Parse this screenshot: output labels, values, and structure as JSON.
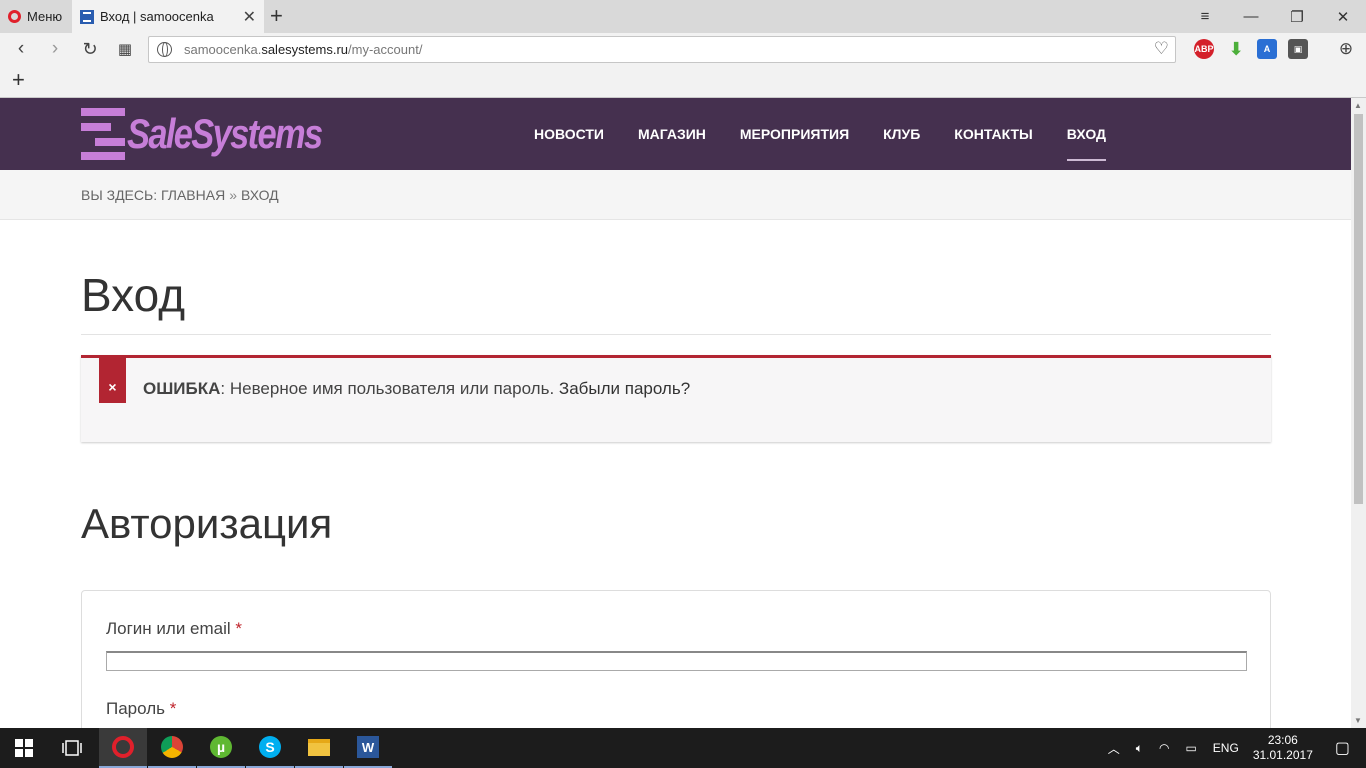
{
  "browser": {
    "menu_label": "Меню",
    "tab_title": "Вход | samoocenka",
    "url_prefix": "samoocenka.",
    "url_host": "salesystems.ru",
    "url_path": "/my-account/",
    "extensions": [
      {
        "name": "adblock-icon",
        "label": "ABP",
        "color": "#d4202a"
      },
      {
        "name": "download-arrow-icon",
        "label": "",
        "color": "#4caf3a"
      },
      {
        "name": "translate-icon",
        "label": "A",
        "color": "#2a6fd4"
      },
      {
        "name": "screenshot-icon",
        "label": "",
        "color": "#555555"
      }
    ]
  },
  "site": {
    "logo_text": "SaleSystems",
    "brand_color": "#45304f",
    "accent_color": "#c77ed8",
    "nav": [
      {
        "label": "НОВОСТИ",
        "active": false
      },
      {
        "label": "МАГАЗИН",
        "active": false
      },
      {
        "label": "МЕРОПРИЯТИЯ",
        "active": false
      },
      {
        "label": "КЛУБ",
        "active": false
      },
      {
        "label": "КОНТАКТЫ",
        "active": false
      },
      {
        "label": "ВХОД",
        "active": true
      }
    ],
    "breadcrumb": {
      "prefix": "ВЫ ЗДЕСЬ:",
      "home": "ГЛАВНАЯ",
      "separator": "»",
      "current": "ВХОД"
    }
  },
  "page": {
    "title": "Вход",
    "error": {
      "icon": "×",
      "label": "ОШИБКА",
      "message": ": Неверное имя пользователя или пароль.",
      "link": "Забыли пароль?",
      "color": "#b22532"
    },
    "section_title": "Авторизация",
    "form": {
      "login_label": "Логин или email",
      "password_label": "Пароль",
      "required_mark": "*",
      "login_value": ""
    }
  },
  "taskbar": {
    "apps": [
      "opera",
      "chrome",
      "utorrent",
      "skype",
      "explorer",
      "word"
    ],
    "language": "ENG",
    "time": "23:06",
    "date": "31.01.2017"
  }
}
